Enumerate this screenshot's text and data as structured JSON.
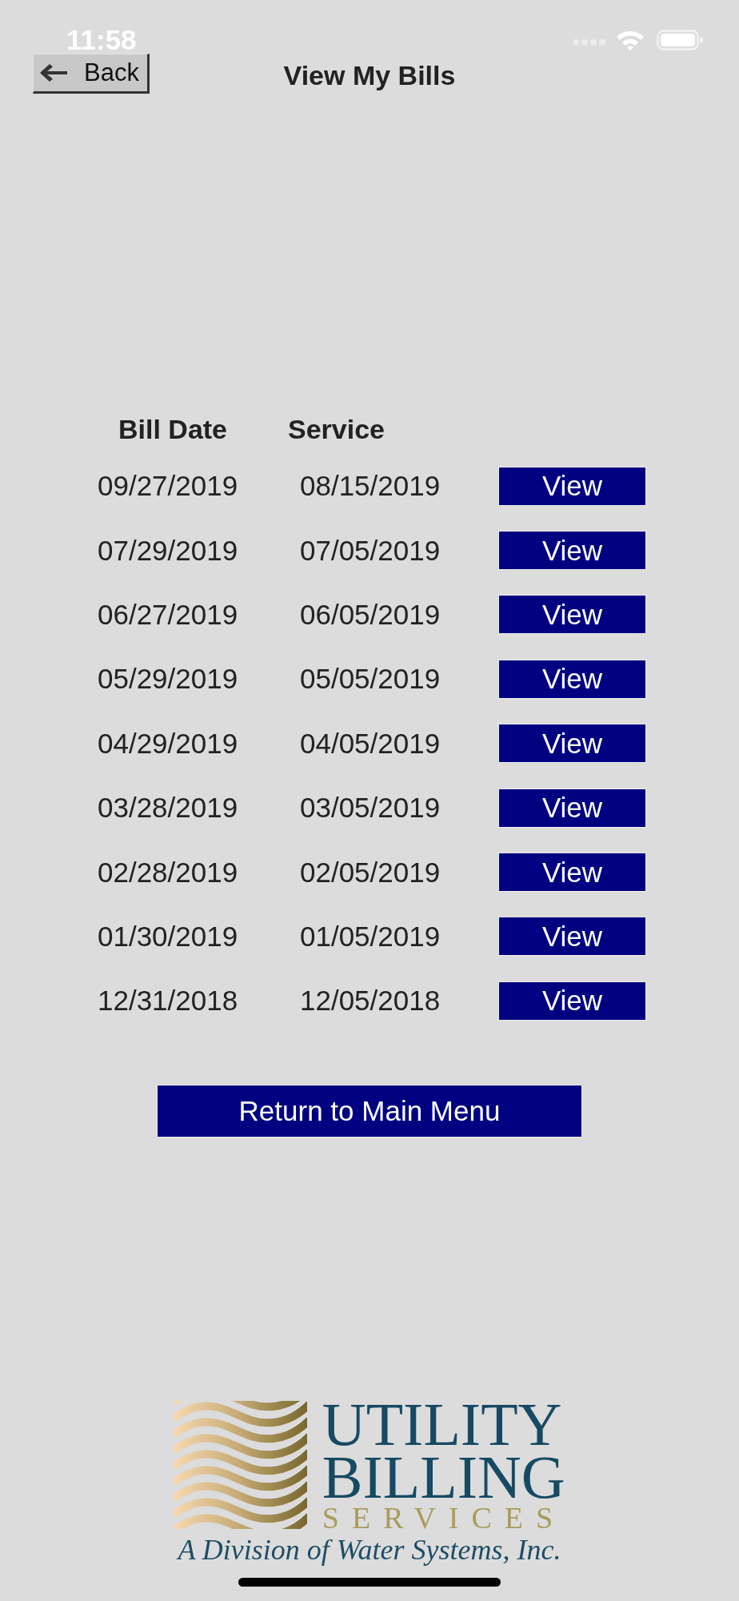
{
  "status_bar": {
    "time": "11:58"
  },
  "header": {
    "back_button": "Back",
    "title": "View My Bills"
  },
  "bills_table": {
    "columns": [
      "Bill Date",
      "Service"
    ],
    "rows": [
      {
        "bill_date": "09/27/2019",
        "service": "08/15/2019",
        "action": "View"
      },
      {
        "bill_date": "07/29/2019",
        "service": "07/05/2019",
        "action": "View"
      },
      {
        "bill_date": "06/27/2019",
        "service": "06/05/2019",
        "action": "View"
      },
      {
        "bill_date": "05/29/2019",
        "service": "05/05/2019",
        "action": "View"
      },
      {
        "bill_date": "04/29/2019",
        "service": "04/05/2019",
        "action": "View"
      },
      {
        "bill_date": "03/28/2019",
        "service": "03/05/2019",
        "action": "View"
      },
      {
        "bill_date": "02/28/2019",
        "service": "02/05/2019",
        "action": "View"
      },
      {
        "bill_date": "01/30/2019",
        "service": "01/05/2019",
        "action": "View"
      },
      {
        "bill_date": "12/31/2018",
        "service": "12/05/2018",
        "action": "View"
      }
    ]
  },
  "return_button": "Return to Main Menu",
  "logo": {
    "line_1": "UTILITY",
    "line_2": "BILLING",
    "line_3": "SERVICES",
    "tagline": "A Division of Water Systems, Inc."
  }
}
